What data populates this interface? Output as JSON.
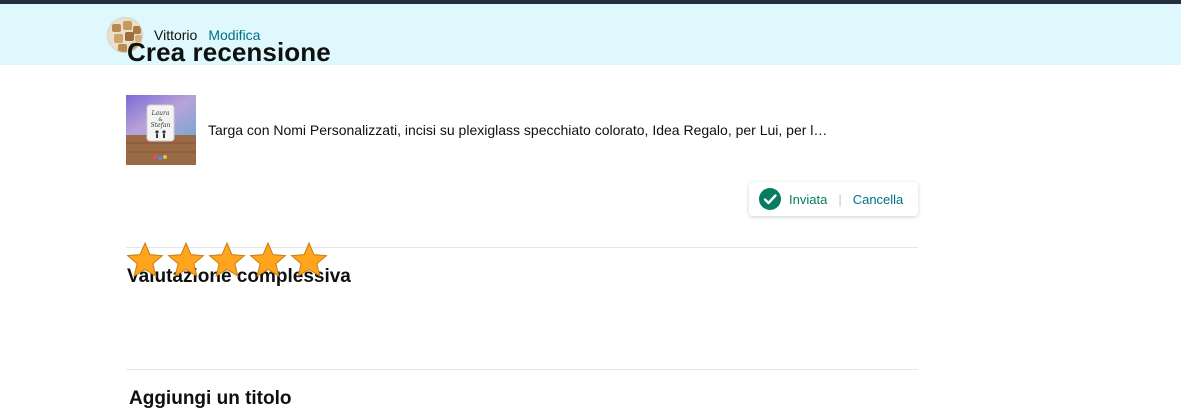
{
  "user": {
    "name": "Vittorio",
    "edit_label": "Modifica",
    "avatar": "avatar-photo"
  },
  "page": {
    "title": "Crea recensione"
  },
  "product": {
    "thumbnail": "product-image",
    "title": "Targa con Nomi Personalizzati, incisi su plexiglass specchiato colorato, Idea Regalo, per Lui, per l…"
  },
  "rating": {
    "section_title": "Valutazione complessiva",
    "stars_selected": 5,
    "stars_total": 5
  },
  "status": {
    "icon": "check-circle-icon",
    "text": "Inviata",
    "separator": "|",
    "cancel_label": "Cancella"
  },
  "title_section": {
    "label": "Aggiungi un titolo"
  },
  "colors": {
    "header_bg": "#dff8fd",
    "link": "#007185",
    "success": "#067d62",
    "star": "#ffa41c"
  }
}
